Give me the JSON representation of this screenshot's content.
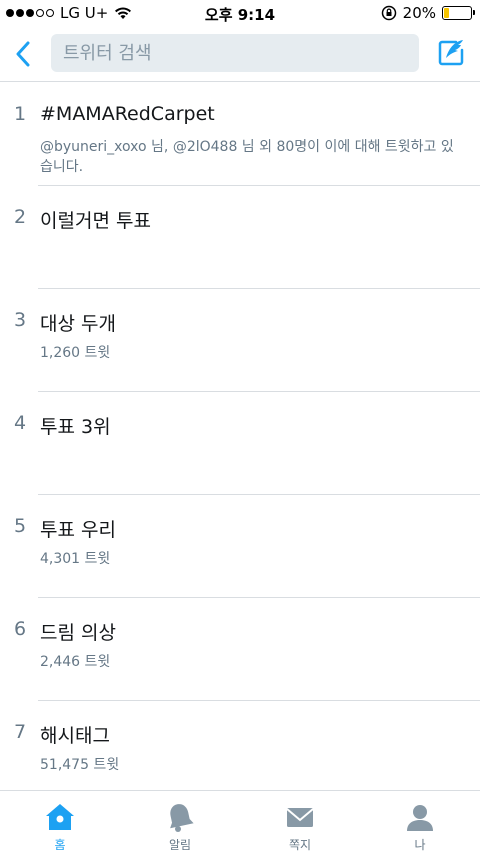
{
  "status_bar": {
    "carrier": "LG U+",
    "time": "오후 9:14",
    "battery_percent": "20%",
    "battery_level": 0.2,
    "signal_icon": "signal-dots-icon",
    "wifi_icon": "wifi-icon",
    "lock_icon": "rotation-lock-icon"
  },
  "nav": {
    "back_icon": "chevron-left-icon",
    "search_placeholder": "트위터 검색",
    "compose_icon": "compose-tweet-icon"
  },
  "trends": [
    {
      "rank": "1",
      "name": "#MAMARedCarpet",
      "meta": "@byuneri_xoxo 님, @2lO488 님 외 80명이 이에 대해 트윗하고 있습니다."
    },
    {
      "rank": "2",
      "name": "이럴거면 투표",
      "meta": ""
    },
    {
      "rank": "3",
      "name": "대상 두개",
      "meta": "1,260 트윗"
    },
    {
      "rank": "4",
      "name": "투표 3위",
      "meta": ""
    },
    {
      "rank": "5",
      "name": "투표 우리",
      "meta": "4,301 트윗"
    },
    {
      "rank": "6",
      "name": "드림 의상",
      "meta": "2,446 트윗"
    },
    {
      "rank": "7",
      "name": "해시태그",
      "meta": "51,475 트윗"
    }
  ],
  "tabbar": {
    "items": [
      {
        "label": "홈",
        "icon": "home-icon",
        "active": true
      },
      {
        "label": "알림",
        "icon": "bell-icon",
        "active": false
      },
      {
        "label": "쪽지",
        "icon": "envelope-icon",
        "active": false
      },
      {
        "label": "나",
        "icon": "user-icon",
        "active": false
      }
    ]
  },
  "colors": {
    "accent": "#1da1f2",
    "muted": "#657786",
    "search_bg": "#e6ecf0",
    "battery": "#f5c400"
  }
}
